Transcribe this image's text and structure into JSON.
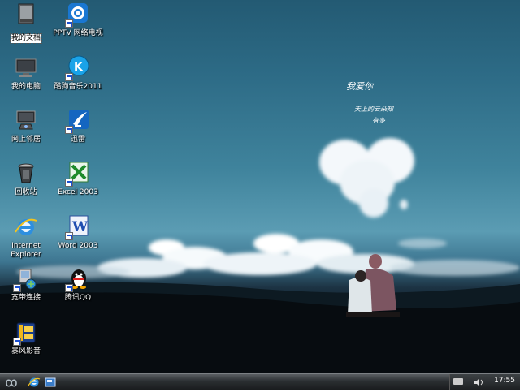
{
  "desktop": {
    "icons": [
      {
        "label": "我的文档",
        "icon": "my-documents-icon"
      },
      {
        "label": "PPTV 网络电视",
        "icon": "pptv-icon"
      },
      {
        "label": "我的电脑",
        "icon": "my-computer-icon"
      },
      {
        "label": "酷狗音乐2011",
        "icon": "kugou-music-icon"
      },
      {
        "label": "网上邻居",
        "icon": "network-places-icon"
      },
      {
        "label": "迅雷",
        "icon": "xunlei-icon"
      },
      {
        "label": "回收站",
        "icon": "recycle-bin-icon"
      },
      {
        "label": "Excel 2003",
        "icon": "excel-icon"
      },
      {
        "label": "Internet Explorer",
        "icon": "internet-explorer-icon"
      },
      {
        "label": "Word 2003",
        "icon": "word-icon"
      },
      {
        "label": "宽带连接",
        "icon": "broadband-connection-icon"
      },
      {
        "label": "腾讯QQ",
        "icon": "qq-icon"
      },
      {
        "label": "暴风影音",
        "icon": "baofeng-player-icon"
      }
    ]
  },
  "wallpaper": {
    "text_lines": [
      "我爱你",
      "天上的云朵知",
      "有多"
    ]
  },
  "taskbar": {
    "clock": "17:55"
  }
}
